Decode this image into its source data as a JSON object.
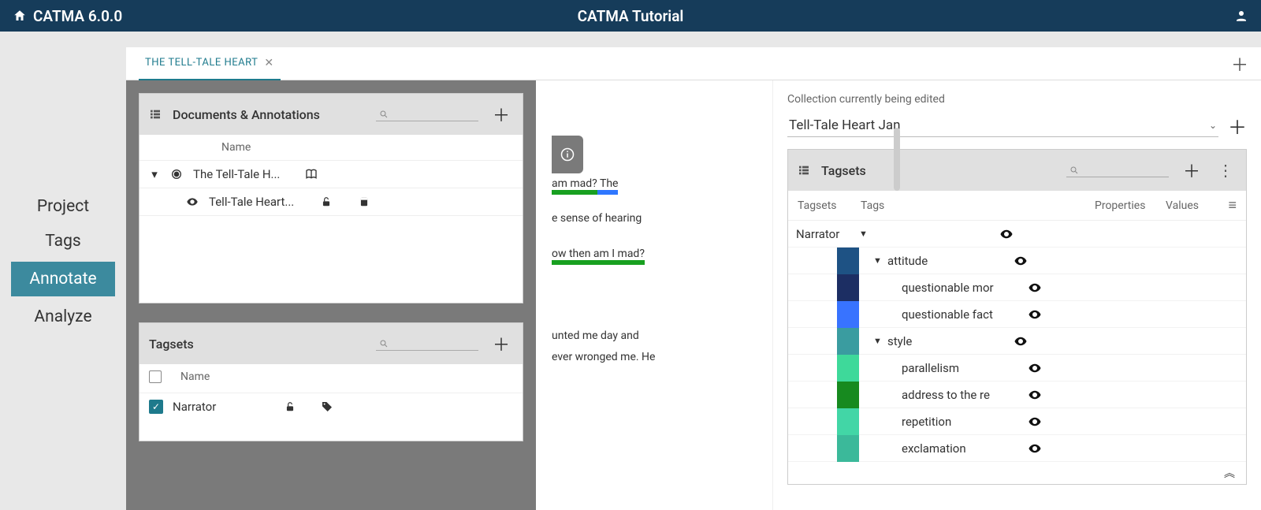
{
  "header": {
    "app_name": "CATMA 6.0.0",
    "title": "CATMA Tutorial"
  },
  "sidebar": {
    "items": [
      {
        "label": "Project"
      },
      {
        "label": "Tags"
      },
      {
        "label": "Annotate"
      },
      {
        "label": "Analyze"
      }
    ],
    "active_index": 2
  },
  "tabstrip": {
    "tabs": [
      {
        "label": "THE TELL-TALE HEART"
      }
    ]
  },
  "docs_panel": {
    "title": "Documents & Annotations",
    "col_name": "Name",
    "rows": [
      {
        "name": "The Tell-Tale H...",
        "radio_selected": true
      },
      {
        "name": "Tell-Tale Heart..."
      }
    ]
  },
  "tagsets_left_panel": {
    "title": "Tagsets",
    "col_name": "Name",
    "rows": [
      {
        "name": "Narrator",
        "checked": true
      }
    ]
  },
  "middle_text": {
    "line1_prefix": "am mad?",
    "line1_suffix": " The",
    "line2": "e sense of hearing",
    "line3": "ow then am I mad?",
    "line4a": "unted me day and",
    "line4b": "ever wronged me. He"
  },
  "right": {
    "coll_label": "Collection currently being edited",
    "coll_value": "Tell-Tale Heart Jan",
    "tagsets_panel": {
      "title": "Tagsets",
      "cols": {
        "c1": "Tagsets",
        "c2": "Tags",
        "c3": "Properties",
        "c4": "Values"
      },
      "rows": [
        {
          "c1": "Narrator",
          "level": 0,
          "has_caret": true,
          "color": null,
          "label": ""
        },
        {
          "c1": "",
          "level": 1,
          "has_caret": true,
          "color": "#1e5284",
          "label": "attitude"
        },
        {
          "c1": "",
          "level": 2,
          "has_caret": false,
          "color": "#1c2e63",
          "label": "questionable mor"
        },
        {
          "c1": "",
          "level": 2,
          "has_caret": false,
          "color": "#3873ff",
          "label": "questionable fact"
        },
        {
          "c1": "",
          "level": 1,
          "has_caret": true,
          "color": "#3a9ca0",
          "label": "style"
        },
        {
          "c1": "",
          "level": 2,
          "has_caret": false,
          "color": "#3ed99a",
          "label": "parallelism"
        },
        {
          "c1": "",
          "level": 2,
          "has_caret": false,
          "color": "#178a1f",
          "label": "address to the re"
        },
        {
          "c1": "",
          "level": 2,
          "has_caret": false,
          "color": "#42d6a6",
          "label": "repetition"
        },
        {
          "c1": "",
          "level": 2,
          "has_caret": false,
          "color": "#3bb99a",
          "label": "exclamation"
        }
      ]
    }
  }
}
